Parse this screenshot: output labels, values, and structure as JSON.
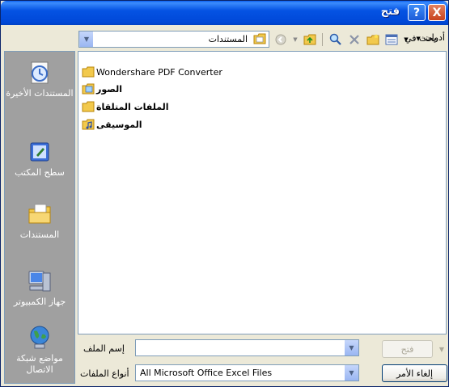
{
  "window": {
    "title": "فتح",
    "help_glyph": "?",
    "close_glyph": "X"
  },
  "toolbar": {
    "look_in_label": "بحث في",
    "look_in_value": "المستندات",
    "tools_label": "أدوات"
  },
  "places": [
    {
      "label": "المستندات الأخيرة"
    },
    {
      "label": "سطح المكتب"
    },
    {
      "label": "المستندات"
    },
    {
      "label": "جهاز الكمبيوتر"
    },
    {
      "label": "مواضع شبكة الاتصال"
    }
  ],
  "files": [
    {
      "name": "Wondershare PDF Converter"
    },
    {
      "name": "الصور"
    },
    {
      "name": "الملفات المتلقاة"
    },
    {
      "name": "الموسيقى"
    }
  ],
  "bottom": {
    "file_name_label": "إسم الملف",
    "file_name_value": "",
    "file_types_label": "أنواع الملفات",
    "file_types_value": "All Microsoft Office Excel Files",
    "open_label": "فتح",
    "cancel_label": "إلغاء الأمر"
  },
  "colors": {
    "title_bar": "#0553E3",
    "places_bg": "#A0A0A0",
    "folder": "#F2C94C"
  }
}
